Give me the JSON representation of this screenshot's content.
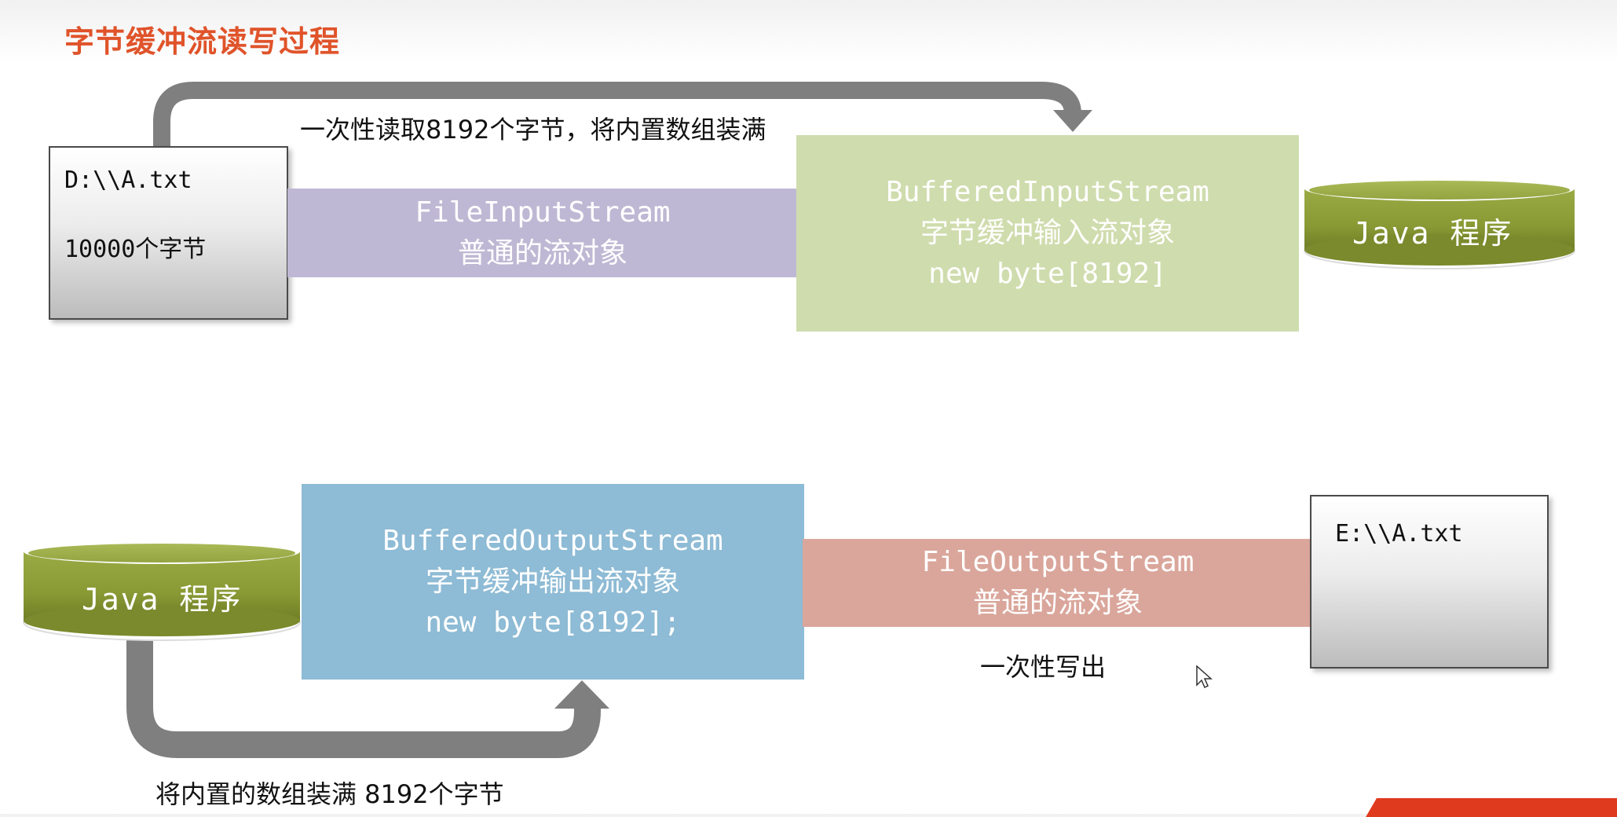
{
  "slide": {
    "title": "字节缓冲流读写过程"
  },
  "read": {
    "source_file": {
      "path": "D:\\\\A.txt",
      "size": "10000个字节"
    },
    "arrow_caption": "一次性读取8192个字节，将内置数组装满",
    "file_input_stream": {
      "class": "FileInputStream",
      "desc": "普通的流对象"
    },
    "buffered_input_stream": {
      "class": "BufferedInputStream",
      "desc": "字节缓冲输入流对象",
      "buffer": "new byte[8192]"
    },
    "program": "Java 程序"
  },
  "write": {
    "program": "Java 程序",
    "buffered_output_stream": {
      "class": "BufferedOutputStream",
      "desc": "字节缓冲输出流对象",
      "buffer": "new byte[8192];"
    },
    "file_output_stream": {
      "class": "FileOutputStream",
      "desc": "普通的流对象"
    },
    "target_file": {
      "path": "E:\\\\A.txt"
    },
    "write_caption": "一次性写出",
    "arrow_caption": "将内置的数组装满  8192个字节"
  },
  "colors": {
    "title": "#e0532a",
    "file_input_band": "#bfb8d4",
    "buffered_input_box": "#cfdcad",
    "buffered_output_box": "#8ebbd5",
    "file_output_band": "#daa69b",
    "cylinder": "#8a9b3a",
    "arrow": "#7f7f7f"
  },
  "icons": {
    "cursor": "mouse-pointer-icon"
  }
}
